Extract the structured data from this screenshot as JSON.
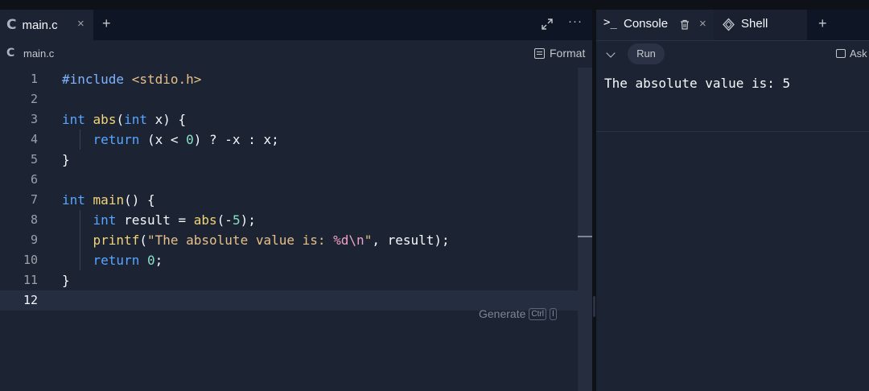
{
  "editor": {
    "tab_label": "main.c",
    "tab_close": "×",
    "tab_add": "+",
    "more": "···",
    "file_label": "main.c",
    "format_label": "Format",
    "generate_label": "Generate",
    "shortcut_ctrl": "Ctrl",
    "shortcut_key": "I",
    "current_line": 12,
    "lines": [
      "#include <stdio.h>",
      "",
      "int abs(int x) {",
      "    return (x < 0) ? -x : x;",
      "}",
      "",
      "int main() {",
      "    int result = abs(-5);",
      "    printf(\"The absolute value is: %d\\n\", result);",
      "    return 0;",
      "}",
      ""
    ]
  },
  "console": {
    "prompt_symbol": ">_",
    "tab_label": "Console",
    "tab_close": "×",
    "shell_label": "Shell",
    "tab_add": "+",
    "run_label": "Run",
    "ask_label": "Ask",
    "output": "The absolute value is: 5"
  },
  "icons": {
    "file": "c-language-icon",
    "expand": "expand-arrows-icon",
    "more": "more-dots-icon",
    "format": "format-icon",
    "terminal": "terminal-prompt-icon",
    "trash": "trash-icon",
    "shell": "shell-icon",
    "chevron": "chevron-down-icon",
    "ask": "chat-bubble-icon"
  },
  "colors": {
    "background": "#1c2333",
    "tabbar": "#0e1525",
    "keyword": "#58a6ff",
    "function": "#f2d479",
    "number": "#87e0c4",
    "string": "#e7c08a",
    "escape": "#f0a1c6"
  }
}
